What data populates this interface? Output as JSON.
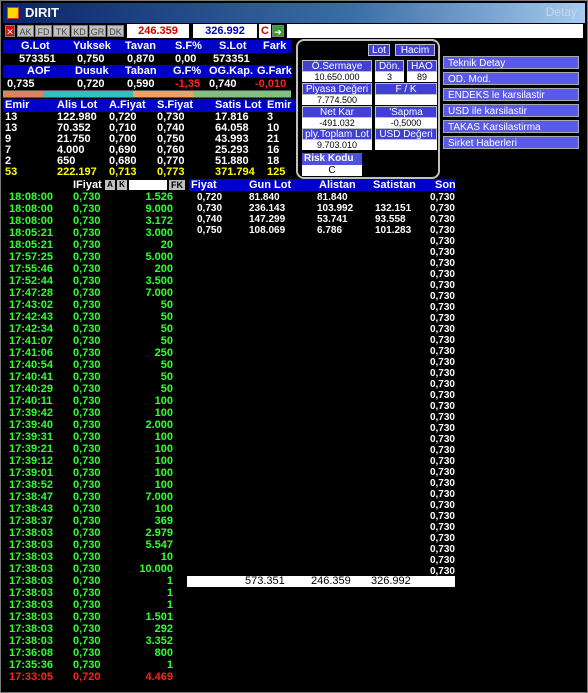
{
  "window": {
    "title": "DIRIT",
    "right_title": "Detay"
  },
  "toolbar": {
    "buttons": [
      "AK",
      "FD",
      "TK",
      "KD",
      "GR",
      "DK"
    ],
    "val1": "246.359",
    "val2": "326.992",
    "c_label": "C"
  },
  "summary": {
    "headers1": [
      "G.Lot",
      "Yuksek",
      "Tavan",
      "S.F%",
      "S.Lot",
      "Fark"
    ],
    "values1": [
      "573351",
      "0,750",
      "0,870",
      "0,00",
      "573351",
      ""
    ],
    "headers2": [
      "AOF",
      "Dusuk",
      "Taban",
      "G.F%",
      "OG.Kap.",
      "G.Fark"
    ],
    "values2": [
      "0,735",
      "0,720",
      "0,590",
      "-1,35",
      "0,740",
      "-0,010"
    ]
  },
  "orders": {
    "headers": [
      "Emir",
      "Alis Lot",
      "A.Fiyat",
      "S.Fiyat",
      "Satis Lot",
      "Emir"
    ],
    "rows": [
      [
        "13",
        "122.980",
        "0,720",
        "0,730",
        "17.816",
        "3"
      ],
      [
        "13",
        "70.352",
        "0,710",
        "0,740",
        "64.058",
        "10"
      ],
      [
        "9",
        "21.750",
        "0,700",
        "0,750",
        "43.993",
        "21"
      ],
      [
        "7",
        "4.000",
        "0,690",
        "0,760",
        "25.293",
        "16"
      ],
      [
        "2",
        "650",
        "0,680",
        "0,770",
        "51.880",
        "18"
      ],
      [
        "53",
        "222.197",
        "0,713",
        "0,773",
        "371.794",
        "125"
      ]
    ]
  },
  "info": {
    "lot": "Lot",
    "hacim": "Hacim",
    "osermaye_label": "Ö.Sermaye",
    "osermaye": "10.650.000",
    "don_label": "Dön.",
    "don": "3",
    "hao_label": "HAO",
    "hao": "89",
    "piyasa_label": "Piyasa Değeri",
    "piyasa": "7.774.500",
    "fk_label": "F / K",
    "fk": "",
    "netkar_label": "Net Kar",
    "netkar": "-491.032",
    "sapma_label": "'Sapma",
    "sapma": "-0,5000",
    "toplamlot_label": "ply.Toplam Lot",
    "toplamlot": "9.703.010",
    "usd_label": "USD Değeri",
    "usd": "",
    "risk_label": "Risk Kodu",
    "risk": "C"
  },
  "menu": [
    "Teknik Detay",
    "OD. Mod.",
    "ENDEKS le karsilastir",
    "USD ile karsilastir",
    "TAKAS Karsilastirma",
    "Sirket Haberleri"
  ],
  "trades": {
    "headers": {
      "fiyat": "IFiyat",
      "a": "A",
      "k": "K",
      "fk": "FK"
    },
    "rows": [
      [
        "18:08:00",
        "0,730",
        "1.526"
      ],
      [
        "18:08:00",
        "0,730",
        "9.000"
      ],
      [
        "18:08:00",
        "0,730",
        "3.172"
      ],
      [
        "18:05:21",
        "0,730",
        "3.000"
      ],
      [
        "18:05:21",
        "0,730",
        "20"
      ],
      [
        "17:57:25",
        "0,730",
        "5.000"
      ],
      [
        "17:55:46",
        "0,730",
        "200"
      ],
      [
        "17:52:44",
        "0,730",
        "3.500"
      ],
      [
        "17:47:28",
        "0,730",
        "7.000"
      ],
      [
        "17:43:02",
        "0,730",
        "50"
      ],
      [
        "17:42:43",
        "0,730",
        "50"
      ],
      [
        "17:42:34",
        "0,730",
        "50"
      ],
      [
        "17:41:07",
        "0,730",
        "50"
      ],
      [
        "17:41:06",
        "0,730",
        "250"
      ],
      [
        "17:40:54",
        "0,730",
        "50"
      ],
      [
        "17:40:41",
        "0,730",
        "50"
      ],
      [
        "17:40:29",
        "0,730",
        "50"
      ],
      [
        "17:40:11",
        "0,730",
        "100"
      ],
      [
        "17:39:42",
        "0,730",
        "100"
      ],
      [
        "17:39:40",
        "0,730",
        "2.000"
      ],
      [
        "17:39:31",
        "0,730",
        "100"
      ],
      [
        "17:39:21",
        "0,730",
        "100"
      ],
      [
        "17:39:12",
        "0,730",
        "100"
      ],
      [
        "17:39:01",
        "0,730",
        "100"
      ],
      [
        "17:38:52",
        "0,730",
        "100"
      ],
      [
        "17:38:47",
        "0,730",
        "7.000"
      ],
      [
        "17:38:43",
        "0,730",
        "100"
      ],
      [
        "17:38:37",
        "0,730",
        "369"
      ],
      [
        "17:38:03",
        "0,730",
        "2.979"
      ],
      [
        "17:38:03",
        "0,730",
        "5.547"
      ],
      [
        "17:38:03",
        "0,730",
        "10"
      ],
      [
        "17:38:03",
        "0,730",
        "10.000"
      ],
      [
        "17:38:03",
        "0,730",
        "1"
      ],
      [
        "17:38:03",
        "0,730",
        "1"
      ],
      [
        "17:38:03",
        "0,730",
        "1"
      ],
      [
        "17:38:03",
        "0,730",
        "1.501"
      ],
      [
        "17:38:03",
        "0,730",
        "292"
      ],
      [
        "17:38:03",
        "0,730",
        "3.352"
      ],
      [
        "17:36:08",
        "0,730",
        "800"
      ],
      [
        "17:35:36",
        "0,730",
        "1"
      ],
      [
        "17:33:05",
        "0,720",
        "4.469"
      ]
    ]
  },
  "depth": {
    "headers": [
      "Fiyat",
      "Gun Lot",
      "Alistan",
      "Satistan",
      "Son"
    ],
    "rows": [
      [
        "0,720",
        "81.840",
        "81.840",
        ""
      ],
      [
        "0,730",
        "236.143",
        "103.992",
        "132.151"
      ],
      [
        "0,740",
        "147.299",
        "53.741",
        "93.558"
      ],
      [
        "0,750",
        "108.069",
        "6.786",
        "101.283"
      ]
    ],
    "son": "0,730",
    "son_count": 36,
    "totals": [
      "573.351",
      "246.359",
      "326.992"
    ]
  }
}
